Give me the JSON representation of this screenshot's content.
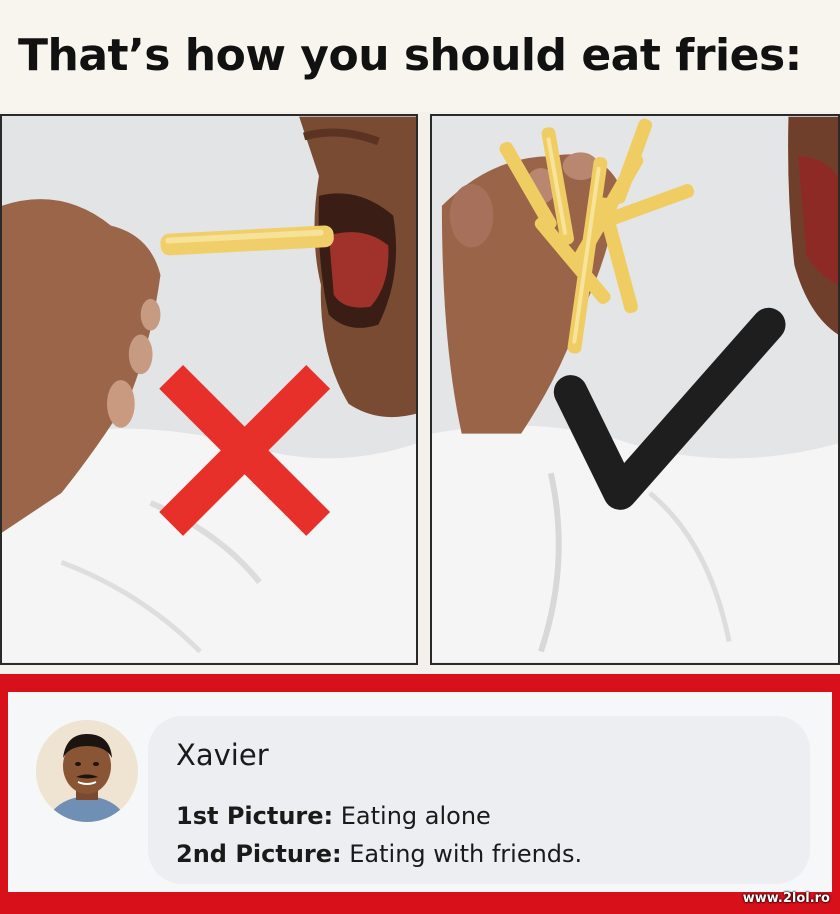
{
  "title": "That’s how you should eat fries:",
  "panels": [
    {
      "mark": "cross-icon",
      "mark_color": "#e8302a"
    },
    {
      "mark": "checkmark-icon",
      "mark_color": "#1e1e1e"
    }
  ],
  "comment": {
    "author": "Xavier",
    "lines": [
      {
        "label": "1st Picture:",
        "text": " Eating alone"
      },
      {
        "label": "2nd Picture:",
        "text": " Eating with friends."
      }
    ]
  },
  "watermark": "www.2lol.ro",
  "colors": {
    "frame_red": "#d8101a",
    "bubble": "#eceef1",
    "title_bg": "#f8f5ee"
  }
}
